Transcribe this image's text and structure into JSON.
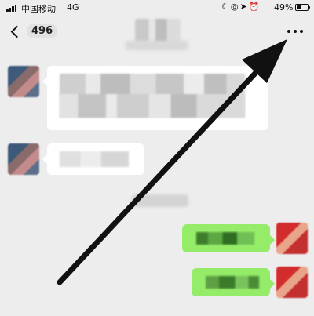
{
  "status_bar": {
    "carrier": "中国移动",
    "network": "4G",
    "icons": [
      "moon-icon",
      "location-lock-icon",
      "location-arrow-icon",
      "alarm-icon"
    ],
    "battery_percent": "49%",
    "battery_level": 0.49
  },
  "nav": {
    "unread_count": "496",
    "back_icon": "chevron-left-icon",
    "more_icon": "more-dots-icon"
  },
  "colors": {
    "background": "#ededed",
    "bubble_incoming": "#ffffff",
    "bubble_outgoing": "#95ec69",
    "annotation_arrow": "#111111"
  },
  "annotation": {
    "type": "arrow",
    "points_to": "more-button"
  }
}
